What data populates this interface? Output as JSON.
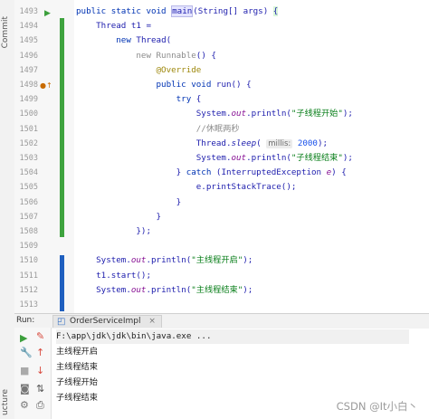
{
  "left_tabs": {
    "commit": "Commit",
    "structure": "ucture"
  },
  "editor": {
    "lines": [
      {
        "n": "1493",
        "html": "<span class='kw'>public static void</span> <span class='hl'>main</span>(String[] args) <span style='color:#1d1dad;background:#d9f7d9'>{</span>"
      },
      {
        "n": "1494",
        "html": "    Thread t1 ="
      },
      {
        "n": "1495",
        "html": "        <span class='kw'>new</span> Thread("
      },
      {
        "n": "1496",
        "html": "            <span style='color:#8c8c8c'>new Runnable</span>() {"
      },
      {
        "n": "1497",
        "html": "                <span class='ann'>@Override</span>"
      },
      {
        "n": "1498",
        "html": "                <span class='kw'>public void</span> run() {"
      },
      {
        "n": "1499",
        "html": "                    <span class='kw'>try</span> {"
      },
      {
        "n": "1500",
        "html": "                        System.<span class='it'>out</span>.println(<span class='str'>\"子线程开始\"</span>);"
      },
      {
        "n": "1501",
        "html": "                        <span class='cm'>//休眠两秒</span>"
      },
      {
        "n": "1502",
        "html": "                        Thread.<span style='font-style:italic'>sleep</span>( <span class='hint'>millis:</span> <span class='num'>2000</span>);"
      },
      {
        "n": "1503",
        "html": "                        System.<span class='it'>out</span>.println(<span class='str'>\"子线程结束\"</span>);"
      },
      {
        "n": "1504",
        "html": "                    } <span class='kw'>catch</span> (InterruptedException <span class='it'>e</span>) {"
      },
      {
        "n": "1505",
        "html": "                        e.printStackTrace();"
      },
      {
        "n": "1506",
        "html": "                    }"
      },
      {
        "n": "1507",
        "html": "                }"
      },
      {
        "n": "1508",
        "html": "            });"
      },
      {
        "n": "1509",
        "html": ""
      },
      {
        "n": "1510",
        "html": "    System.<span class='it'>out</span>.println(<span class='str'>\"主线程开启\"</span>);"
      },
      {
        "n": "1511",
        "html": "    t1.start();"
      },
      {
        "n": "1512",
        "html": "    System.<span class='it'>out</span>.println(<span class='str'>\"主线程结束\"</span>);"
      },
      {
        "n": "1513",
        "html": ""
      }
    ]
  },
  "run": {
    "label": "Run:",
    "tab": "OrderServiceImpl",
    "tab_close": "×",
    "output": [
      "F:\\app\\jdk\\jdk\\bin\\java.exe ...",
      "主线程开启",
      "主线程结束",
      "子线程开始",
      "子线程结束"
    ]
  },
  "watermark": "CSDN @It小白丶",
  "colors": {
    "added": "#3ea33e",
    "modified": "#1f5fbf",
    "run": "#3c9f3c",
    "stop": "#d84b3f"
  }
}
